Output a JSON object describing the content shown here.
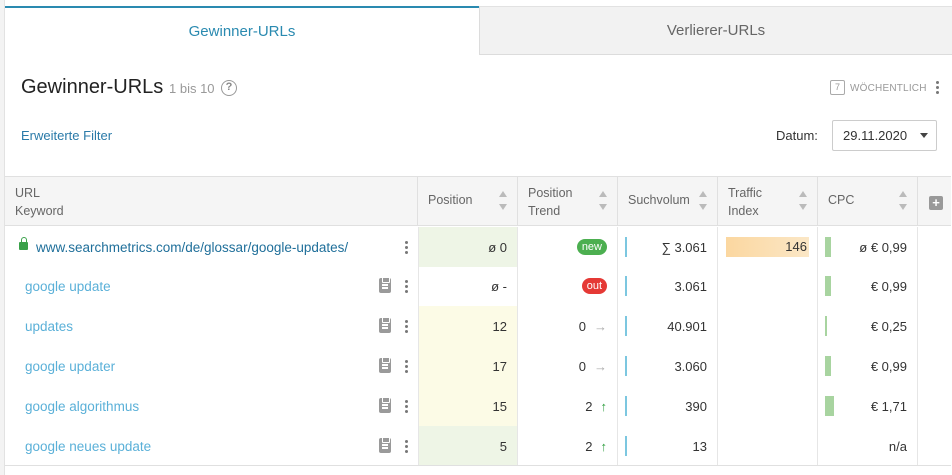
{
  "tabs": {
    "active": "Gewinner-URLs",
    "inactive": "Verlierer-URLs"
  },
  "header": {
    "title": "Gewinner-URLs",
    "range": "1 bis 10",
    "help": "?",
    "weekly_icon_text": "7",
    "weekly": "WÖCHENTLICH"
  },
  "filters": {
    "advanced": "Erweiterte Filter",
    "date_label": "Datum:",
    "date_value": "29.11.2020"
  },
  "columns": {
    "url_line1": "URL",
    "url_line2": "Keyword",
    "position": "Position",
    "trend_line1": "Position",
    "trend_line2": "Trend",
    "volume": "Suchvolum",
    "ti_line1": "Traffic",
    "ti_line2": "Index",
    "cpc": "CPC"
  },
  "rows": [
    {
      "text": "www.searchmetrics.com/de/glossar/google-updates/",
      "position": "ø 0",
      "trend_badge": "new",
      "volume": "∑ 3.061",
      "traffic_index": "146",
      "traffic_index_fraction": 0.83,
      "cpc": "ø € 0,99"
    },
    {
      "text": "google update",
      "position": "ø -",
      "trend_badge": "out",
      "volume": "3.061",
      "traffic_index": "",
      "cpc": "€ 0,99"
    },
    {
      "text": "updates",
      "position": "12",
      "trend_value": "0",
      "trend_arrow": "→",
      "volume": "40.901",
      "traffic_index": "",
      "cpc": "€ 0,25"
    },
    {
      "text": "google updater",
      "position": "17",
      "trend_value": "0",
      "trend_arrow": "→",
      "volume": "3.060",
      "traffic_index": "",
      "cpc": "€ 0,99"
    },
    {
      "text": "google algorithmus",
      "position": "15",
      "trend_value": "2",
      "trend_arrow": "↑",
      "volume": "390",
      "traffic_index": "",
      "cpc": "€ 1,71"
    },
    {
      "text": "google neues update",
      "position": "5",
      "trend_value": "2",
      "trend_arrow": "↑",
      "volume": "13",
      "traffic_index": "",
      "cpc": "n/a"
    }
  ],
  "colors": {
    "accent": "#2a8ab0",
    "position_bg_green": "#eef5e6",
    "position_bg_yellow": "#fcfbe6",
    "badge_new": "#4caf50",
    "badge_out": "#e53935",
    "trend_up": "#2e9e3e"
  }
}
